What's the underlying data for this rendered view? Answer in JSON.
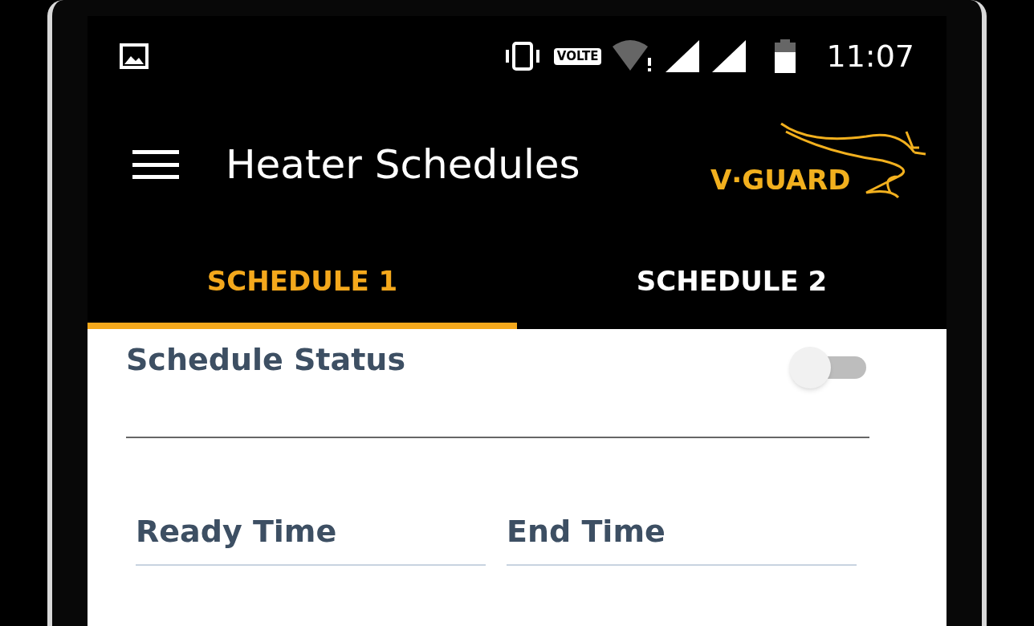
{
  "status_bar": {
    "volte": "VOLTE",
    "time": "11:07"
  },
  "app_bar": {
    "title": "Heater Schedules",
    "logo_text": "V·GUARD"
  },
  "tabs": [
    {
      "label": "SCHEDULE 1",
      "selected": true
    },
    {
      "label": "SCHEDULE 2",
      "selected": false
    }
  ],
  "schedule_status": {
    "label": "Schedule Status",
    "on": false
  },
  "fields": [
    {
      "label": "Ready Time"
    },
    {
      "label": "End Time"
    }
  ]
}
